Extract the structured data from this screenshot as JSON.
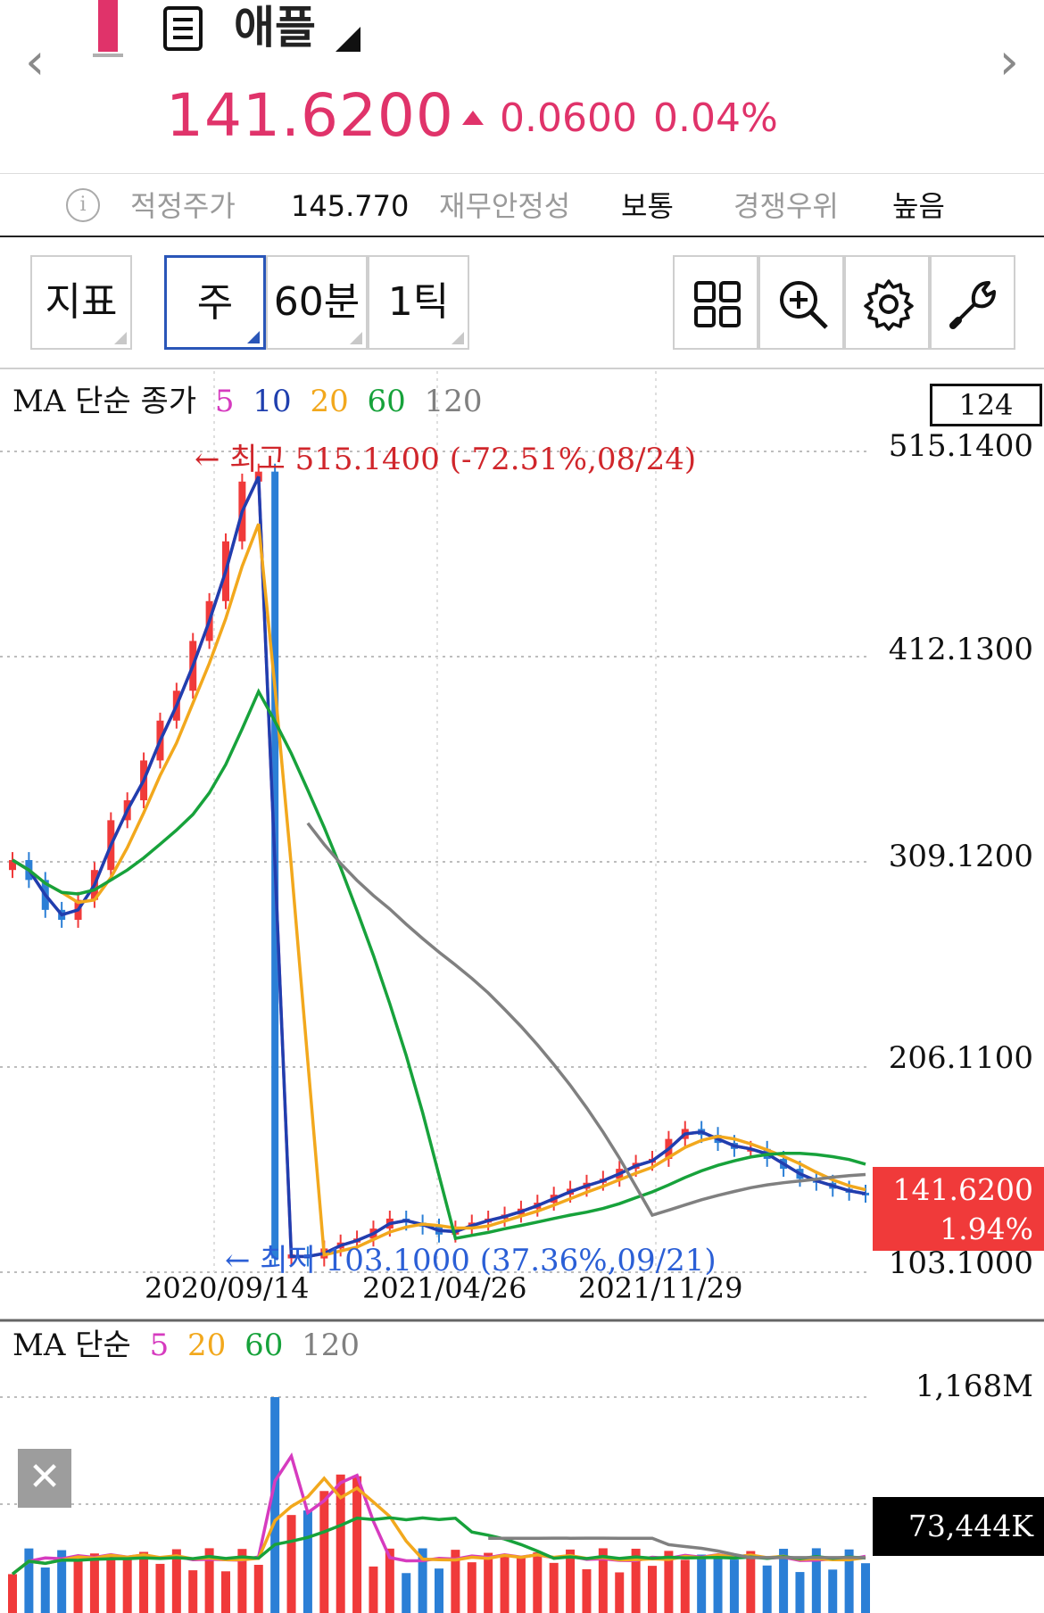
{
  "header": {
    "stock_name": "애플",
    "price": "141.6200",
    "change": "0.0600",
    "change_pct": "0.04%",
    "accent_color": "#e0336a"
  },
  "info": {
    "fair_price_label": "적정주가",
    "fair_price_value": "145.770",
    "financial_stability_label": "재무안정성",
    "financial_stability_value": "보통",
    "competitive_label": "경쟁우위",
    "competitive_value": "높음"
  },
  "toolbar": {
    "indicator_label": "지표",
    "period_week": "주",
    "period_60min": "60분",
    "period_1tick": "1틱",
    "icons": [
      "grid-icon",
      "zoom-in-icon",
      "settings-icon",
      "wrench-icon"
    ]
  },
  "price_chart": {
    "legend_title": "MA 단순 종가",
    "ma_periods": [
      "5",
      "10",
      "20",
      "60",
      "120"
    ],
    "ma_colors": [
      "#d63bbf",
      "#1f3fae",
      "#f2a81d",
      "#17a23b",
      "#808080"
    ],
    "count_box": "124",
    "y_ticks": [
      "515.1400",
      "412.1300",
      "309.1200",
      "206.1100",
      "103.1000"
    ],
    "x_ticks": [
      "2020/09/14",
      "2021/04/26",
      "2021/11/29"
    ],
    "high_annotation": "← 최고 515.1400 (-72.51%,08/24)",
    "low_annotation": "← 최저 103.1000 (37.36%,09/21)",
    "current_price_tag": "141.6200",
    "current_pct_tag": "1.94%",
    "up_color": "#f03a3a",
    "down_color": "#2b7fd6"
  },
  "volume_chart": {
    "legend_title": "MA 단순",
    "ma_periods": [
      "5",
      "20",
      "60",
      "120"
    ],
    "ma_colors": [
      "#d63bbf",
      "#f2a81d",
      "#17a23b",
      "#808080"
    ],
    "max_tick": "1,168M",
    "current_volume": "73,444K"
  },
  "chart_data": {
    "type": "candlestick",
    "title": "애플",
    "ylim": [
      103.1,
      515.14
    ],
    "y_ticks": [
      515.14,
      412.13,
      309.12,
      206.11,
      103.1
    ],
    "x_tick_labels": [
      "2020/09/14",
      "2021/04/26",
      "2021/11/29"
    ],
    "series": [
      {
        "name": "5",
        "type": "line"
      },
      {
        "name": "10",
        "type": "line"
      },
      {
        "name": "20",
        "type": "line"
      },
      {
        "name": "60",
        "type": "line"
      },
      {
        "name": "120",
        "type": "line"
      }
    ],
    "close_approx": [
      310,
      300,
      285,
      280,
      290,
      305,
      330,
      340,
      360,
      380,
      395,
      420,
      440,
      470,
      500,
      505,
      110,
      112,
      110,
      115,
      118,
      120,
      125,
      130,
      128,
      126,
      122,
      125,
      128,
      130,
      132,
      135,
      138,
      142,
      145,
      148,
      150,
      155,
      158,
      160,
      170,
      175,
      172,
      168,
      165,
      165,
      160,
      155,
      150,
      148,
      145,
      143,
      142
    ],
    "highest": 515.14,
    "lowest": 103.1,
    "last": 141.62
  }
}
